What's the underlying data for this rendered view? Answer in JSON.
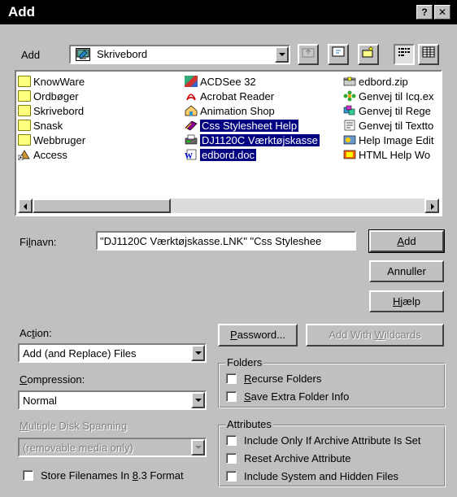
{
  "window": {
    "title": "Add",
    "help_glyph": "?",
    "close_glyph": "✕"
  },
  "lookin": {
    "label": "Add",
    "value": "Skrivebord",
    "toolbar_icons": [
      "up-folder-icon",
      "desktop-icon",
      "new-folder-icon",
      "list-view-icon",
      "details-view-icon"
    ]
  },
  "files": {
    "col1": [
      {
        "name": "KnowWare",
        "icon": "folder-icon"
      },
      {
        "name": "Ordbøger",
        "icon": "folder-icon"
      },
      {
        "name": "Skrivebord",
        "icon": "folder-icon"
      },
      {
        "name": "Snask",
        "icon": "folder-icon"
      },
      {
        "name": "Webbruger",
        "icon": "folder-icon"
      },
      {
        "name": "Access",
        "icon": "access-shortcut-icon"
      }
    ],
    "col2": [
      {
        "name": "ACDSee 32",
        "icon": "acdsee-icon",
        "selected": false
      },
      {
        "name": "Acrobat Reader",
        "icon": "acrobat-icon",
        "selected": false
      },
      {
        "name": "Animation Shop",
        "icon": "animation-shop-icon",
        "selected": false
      },
      {
        "name": "Css Stylesheet Help",
        "icon": "help-book-icon",
        "selected": true
      },
      {
        "name": "DJ1120C Værktøjskasse",
        "icon": "printer-toolbox-icon",
        "selected": true
      },
      {
        "name": "edbord.doc",
        "icon": "word-doc-icon",
        "selected": true
      }
    ],
    "col3": [
      {
        "name": "edbord.zip",
        "icon": "zip-icon"
      },
      {
        "name": "Genvej til Icq.ex",
        "icon": "icq-icon"
      },
      {
        "name": "Genvej til Rege",
        "icon": "regedit-icon"
      },
      {
        "name": "Genvej til Textto",
        "icon": "textto-icon"
      },
      {
        "name": "Help Image Edit",
        "icon": "help-image-icon"
      },
      {
        "name": "HTML Help Wo",
        "icon": "html-help-icon"
      }
    ]
  },
  "filename": {
    "label_pre": "Fi",
    "label_u": "l",
    "label_post": "navn:",
    "value": "\"DJ1120C Værktøjskasse.LNK\" \"Css Styleshee"
  },
  "buttons": {
    "add": {
      "u": "A",
      "rest": "dd"
    },
    "cancel": "Annuller",
    "help": {
      "u": "H",
      "rest": "jælp"
    },
    "password": {
      "u": "P",
      "rest": "assword..."
    },
    "wildcards": {
      "pre": "Add With ",
      "u": "W",
      "rest": "ildcards"
    }
  },
  "action": {
    "label_pre": "Ac",
    "label_u": "t",
    "label_post": "ion:",
    "value": "Add (and Replace) Files"
  },
  "compression": {
    "label_u": "C",
    "label_post": "ompression:",
    "value": "Normal"
  },
  "spanning": {
    "label_u": "M",
    "label_post": "ultiple Disk Spanning",
    "value": "(removable media only)"
  },
  "store83": {
    "pre": "Store Filenames In ",
    "u": "8",
    "rest": ".3 Format",
    "checked": false
  },
  "folders": {
    "title": "Folders",
    "recurse": {
      "u": "R",
      "rest": "ecurse Folders",
      "checked": false
    },
    "save_extra": {
      "u": "S",
      "rest": "ave Extra Folder Info",
      "checked": false
    }
  },
  "attributes": {
    "title": "Attributes",
    "archive_only": {
      "label": "Include Only If Archive Attribute Is Set",
      "checked": false
    },
    "reset_archive": {
      "label": "Reset Archive Attribute",
      "checked": false
    },
    "system_hidden": {
      "label": "Include System and Hidden Files",
      "checked": false
    }
  }
}
